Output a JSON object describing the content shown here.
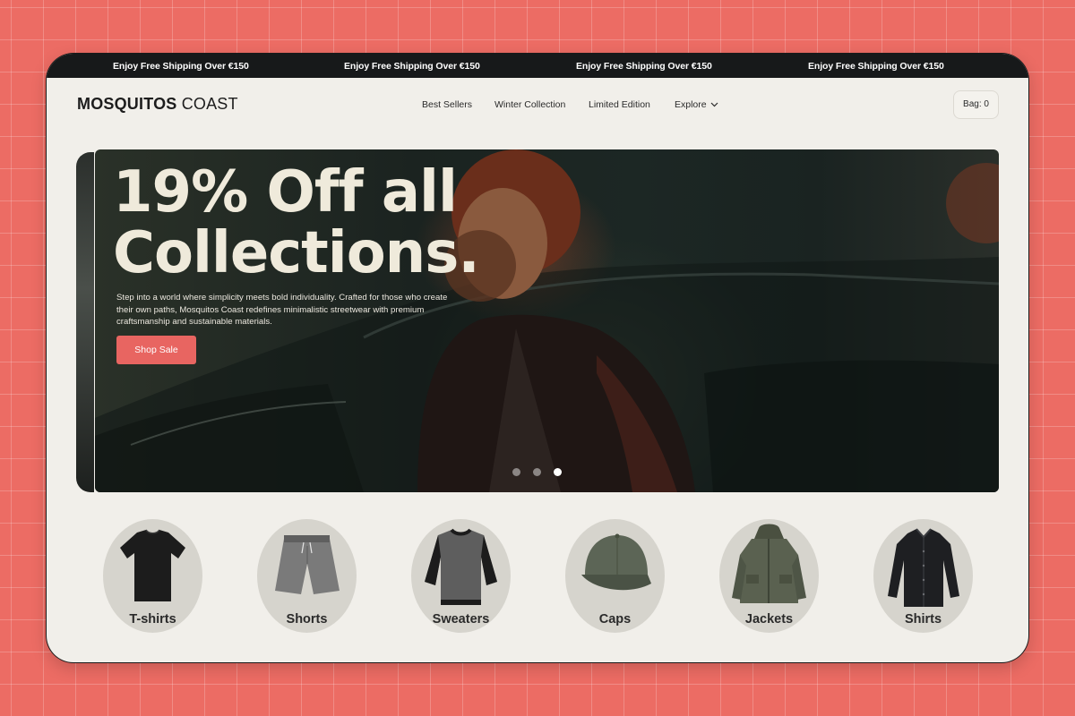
{
  "promo_bar": {
    "messages": [
      "Enjoy Free Shipping Over €150",
      "Enjoy Free Shipping Over €150",
      "Enjoy Free Shipping Over €150",
      "Enjoy Free Shipping Over €150"
    ]
  },
  "header": {
    "logo_bold": "MOSQUITOS",
    "logo_light": "COAST",
    "nav": [
      "Best Sellers",
      "Winter Collection",
      "Limited Edition",
      "Explore"
    ],
    "bag_label": "Bag: 0"
  },
  "hero": {
    "title_line1": "19% Off all",
    "title_line2": "Collections.",
    "description": "Step into a world where simplicity meets bold individuality. Crafted for those who create their own paths, Mosquitos Coast redefines minimalistic streetwear with premium craftsmanship and sustainable materials.",
    "cta_label": "Shop Sale",
    "slides_count": 3,
    "active_slide": 3
  },
  "categories": [
    {
      "label": "T-shirts",
      "icon": "tshirt-icon"
    },
    {
      "label": "Shorts",
      "icon": "shorts-icon"
    },
    {
      "label": "Sweaters",
      "icon": "sweater-icon"
    },
    {
      "label": "Caps",
      "icon": "cap-icon"
    },
    {
      "label": "Jackets",
      "icon": "jacket-icon"
    },
    {
      "label": "Shirts",
      "icon": "shirt-icon"
    }
  ],
  "colors": {
    "page_background": "#ec6c64",
    "promo_bar": "#17191a",
    "surface": "#f1efea",
    "accent": "#e86561",
    "hero_text": "#efeadb"
  }
}
